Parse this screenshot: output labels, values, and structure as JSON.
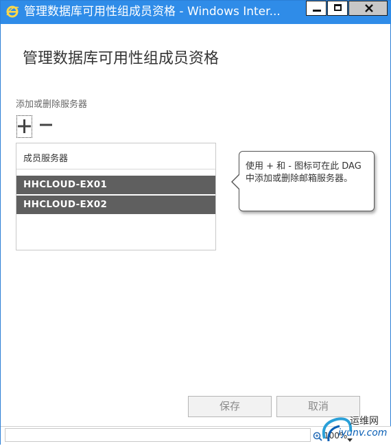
{
  "window": {
    "title": "管理数据库可用性组成员资格 - Windows Inter...",
    "buttons": {
      "minimize": "minimize-icon",
      "maximize": "maximize-icon",
      "close": "close-icon"
    }
  },
  "page": {
    "title": "管理数据库可用性组成员资格"
  },
  "servers_section": {
    "label": "添加或删除服务器",
    "add_icon": "plus-icon",
    "remove_icon": "minus-icon",
    "column_header": "成员服务器",
    "rows": [
      "HHCLOUD-EX01",
      "HHCLOUD-EX02"
    ]
  },
  "callout": {
    "text": "使用 + 和 - 图标可在此 DAG 中添加或删除邮箱服务器。"
  },
  "footer": {
    "save_label": "保存",
    "cancel_label": "取消"
  },
  "statusbar": {
    "zoom_level": "100%"
  },
  "watermark": {
    "line1": "运维网",
    "line2": "iyunv.com"
  },
  "colors": {
    "titlebar": "#2f8ce8",
    "selected_row": "#5f5f5f",
    "close_button": "#c7c7c7"
  }
}
